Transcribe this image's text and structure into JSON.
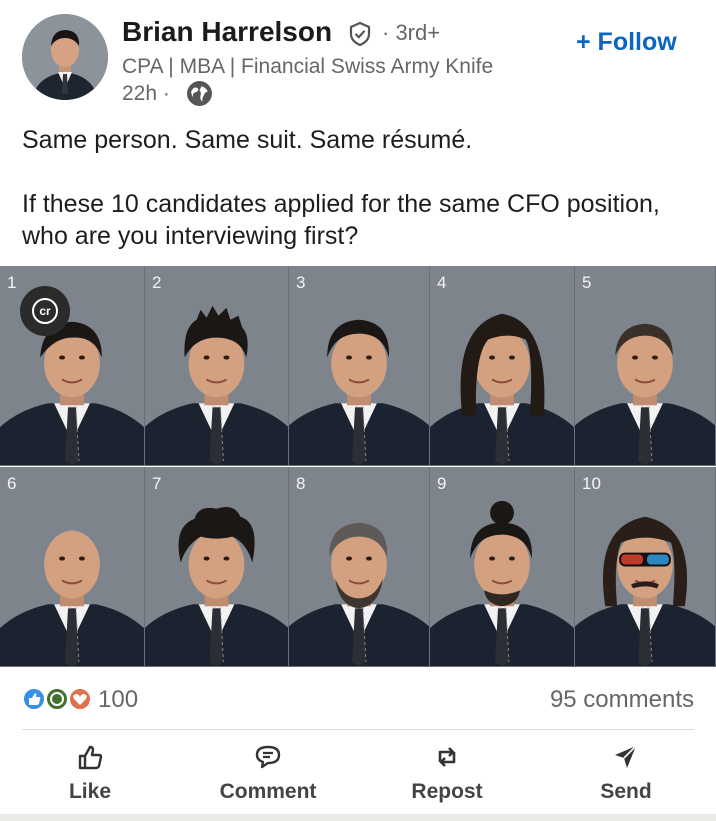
{
  "author": {
    "name": "Brian Harrelson",
    "degree": "· 3rd+",
    "headline": "CPA | MBA | Financial Swiss Army Knife",
    "time": "22h ·"
  },
  "follow_label": "+ Follow",
  "post": {
    "line1": "Same person. Same suit. Same résumé.",
    "line2": "If these 10 candidates applied for the same CFO position, who are you interviewing first?"
  },
  "grid": [
    {
      "number": "1",
      "hair": "short-swept"
    },
    {
      "number": "2",
      "hair": "spiky"
    },
    {
      "number": "3",
      "hair": "short-neat"
    },
    {
      "number": "4",
      "hair": "long"
    },
    {
      "number": "5",
      "hair": "buzz"
    },
    {
      "number": "6",
      "hair": "bald"
    },
    {
      "number": "7",
      "hair": "curly-messy"
    },
    {
      "number": "8",
      "hair": "grey-beard"
    },
    {
      "number": "9",
      "hair": "man-bun"
    },
    {
      "number": "10",
      "hair": "mullet-sunglasses"
    }
  ],
  "badge": "cr",
  "social": {
    "reaction_count": "100",
    "comments": "95 comments"
  },
  "actions": [
    {
      "label": "Like",
      "icon": "thumbs-up-icon"
    },
    {
      "label": "Comment",
      "icon": "comment-icon"
    },
    {
      "label": "Repost",
      "icon": "repost-icon"
    },
    {
      "label": "Send",
      "icon": "send-icon"
    }
  ],
  "colors": {
    "accent": "#0a66c2",
    "text_secondary": "#666666"
  }
}
